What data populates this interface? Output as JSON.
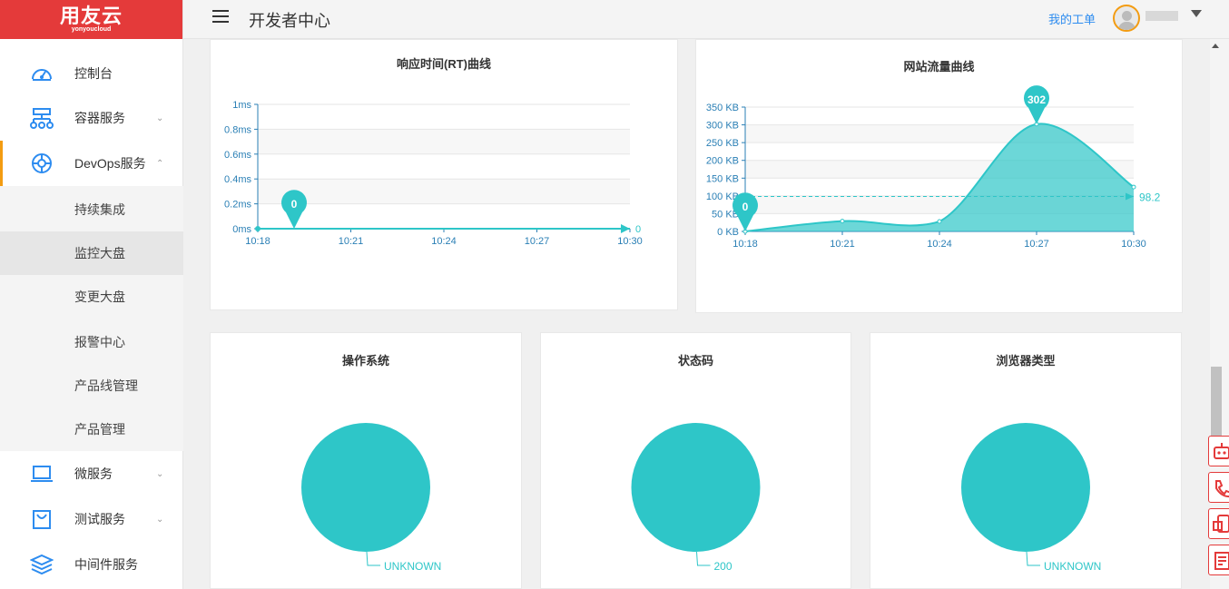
{
  "logo": {
    "main": "用友云",
    "sub": "yonyoucloud"
  },
  "header": {
    "title": "开发者中心",
    "work_order": "我的工单"
  },
  "sidebar": {
    "items": [
      {
        "label": "控制台",
        "icon": "dashboard-icon"
      },
      {
        "label": "容器服务",
        "icon": "container-icon"
      },
      {
        "label": "DevOps服务",
        "icon": "devops-icon"
      },
      {
        "label": "微服务",
        "icon": "laptop-icon"
      },
      {
        "label": "测试服务",
        "icon": "bag-icon"
      },
      {
        "label": "中间件服务",
        "icon": "layers-icon"
      }
    ],
    "subitems": [
      "持续集成",
      "监控大盘",
      "变更大盘",
      "报警中心",
      "产品线管理",
      "产品管理"
    ]
  },
  "colors": {
    "accent": "#2ec6c8",
    "brand": "#e43a3a",
    "link": "#2d8cf0",
    "active_bar": "#f39c12"
  },
  "chart_data": [
    {
      "type": "line",
      "title": "响应时间(RT)曲线",
      "categories": [
        "10:18",
        "10:21",
        "10:24",
        "10:27",
        "10:30"
      ],
      "y_ticks": [
        "0ms",
        "0.2ms",
        "0.4ms",
        "0.6ms",
        "0.8ms",
        "1ms"
      ],
      "values": [
        0,
        0,
        0,
        0,
        0
      ],
      "ylim": [
        0,
        1
      ],
      "max_marker": "0",
      "avg_label": "0"
    },
    {
      "type": "area",
      "title": "网站流量曲线",
      "categories": [
        "10:18",
        "10:21",
        "10:24",
        "10:27",
        "10:30"
      ],
      "y_ticks": [
        "0 KB",
        "50 KB",
        "100 KB",
        "150 KB",
        "200 KB",
        "250 KB",
        "300 KB",
        "350 KB"
      ],
      "values": [
        0,
        29,
        28,
        302,
        125
      ],
      "ylim": [
        0,
        350
      ],
      "max_marker": "302",
      "min_marker": "0",
      "avg_label": "98.2"
    },
    {
      "type": "pie",
      "title": "操作系统",
      "slices": [
        {
          "label": "UNKNOWN",
          "value": 1
        }
      ]
    },
    {
      "type": "pie",
      "title": "状态码",
      "slices": [
        {
          "label": "200",
          "value": 1
        }
      ]
    },
    {
      "type": "pie",
      "title": "浏览器类型",
      "slices": [
        {
          "label": "UNKNOWN",
          "value": 1
        }
      ]
    }
  ]
}
